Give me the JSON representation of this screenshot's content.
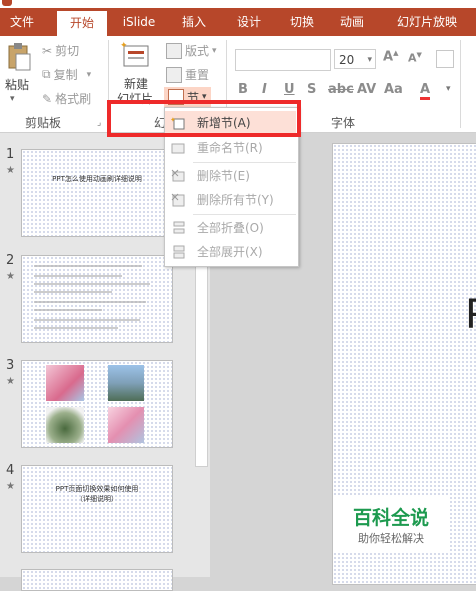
{
  "tabs": [
    {
      "label": "文件"
    },
    {
      "label": "开始"
    },
    {
      "label": "iSlide"
    },
    {
      "label": "插入"
    },
    {
      "label": "设计"
    },
    {
      "label": "切换"
    },
    {
      "label": "动画"
    },
    {
      "label": "幻灯片放映"
    }
  ],
  "ribbon": {
    "paste": "粘贴",
    "cut": "剪切",
    "copy": "复制",
    "format_painter": "格式刷",
    "clipboard_label": "剪贴板",
    "new_slide_line1": "新建",
    "new_slide_line2": "幻灯片",
    "layout": "版式",
    "reset": "重置",
    "section": "节",
    "slides_label_partial": "幻",
    "font_label_partial": "字体",
    "font_size": "20"
  },
  "section_menu": {
    "items": [
      {
        "label": "新增节(A)",
        "enabled": true,
        "icon": "add-section-icon"
      },
      {
        "label": "重命名节(R)",
        "enabled": false,
        "icon": "rename-section-icon"
      },
      {
        "label": "删除节(E)",
        "enabled": false,
        "icon": "delete-section-icon"
      },
      {
        "label": "删除所有节(Y)",
        "enabled": false,
        "icon": "delete-all-sections-icon"
      },
      {
        "label": "全部折叠(O)",
        "enabled": false,
        "icon": "collapse-all-icon"
      },
      {
        "label": "全部展开(X)",
        "enabled": false,
        "icon": "expand-all-icon"
      }
    ]
  },
  "slides": [
    {
      "number": "1",
      "star": "★",
      "title": "PPT怎么使用动画刷详细说明"
    },
    {
      "number": "2",
      "star": "★"
    },
    {
      "number": "3",
      "star": "★"
    },
    {
      "number": "4",
      "star": "★",
      "title": "PPT页面切换效果如何使用",
      "subtitle": "（详细说明）"
    }
  ],
  "main_slide_partial_text": "P",
  "watermark": {
    "title": "百科全说",
    "subtitle": "助你轻松解决"
  },
  "colors": {
    "accent": "#b7472a",
    "highlight": "#ee2a2a",
    "watermark_green": "#1d9a4f"
  }
}
